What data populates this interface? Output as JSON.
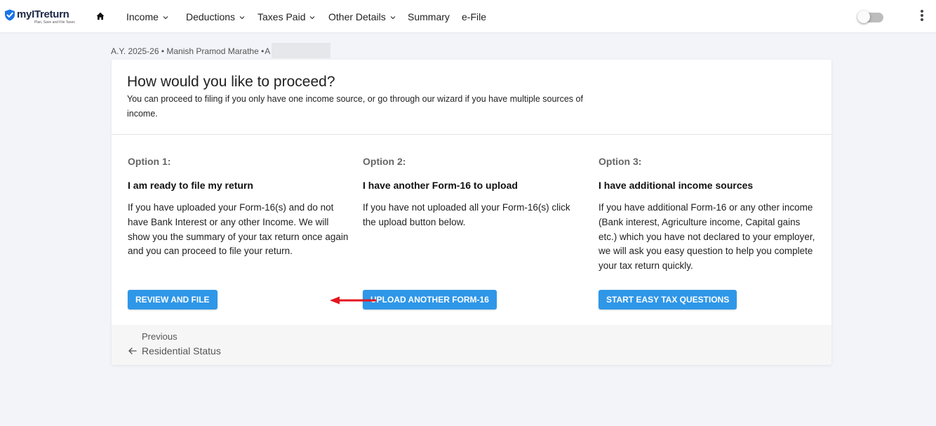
{
  "brand": {
    "name": "myITreturn",
    "tagline": "Plan, Save and File Taxes",
    "accent_color": "#1a73e8",
    "shield_icon": "shield-check-icon"
  },
  "nav": {
    "home_icon": "home-icon",
    "items": [
      {
        "label": "Income",
        "has_dropdown": true
      },
      {
        "label": "Deductions",
        "has_dropdown": true
      },
      {
        "label": "Taxes Paid",
        "has_dropdown": true
      },
      {
        "label": "Other Details",
        "has_dropdown": true
      },
      {
        "label": "Summary",
        "has_dropdown": false
      },
      {
        "label": "e-File",
        "has_dropdown": false
      }
    ],
    "toggle_on": false,
    "menu_icon": "kebab-menu-icon"
  },
  "breadcrumb": {
    "text": "A.Y. 2025-26 • Manish Pramod Marathe • ",
    "redacted_partial": "A"
  },
  "card": {
    "title": "How would you like to proceed?",
    "subtitle": "You can proceed to filing if you only have one income source, or go through our wizard if you have multiple sources of income.",
    "options": [
      {
        "label": "Option 1:",
        "heading": "I am ready to file my return",
        "description": "If you have uploaded your Form-16(s) and do not have Bank Interest or any other Income. We will show you the summary of your tax return once again and you can proceed to file your return.",
        "button": "REVIEW AND FILE"
      },
      {
        "label": "Option 2:",
        "heading": "I have another Form-16 to upload",
        "description": "If you have not uploaded all your Form-16(s) click the upload button below.",
        "button": "UPLOAD ANOTHER FORM-16"
      },
      {
        "label": "Option 3:",
        "heading": "I have additional income sources",
        "description": "If you have additional Form-16 or any other income (Bank interest, Agriculture income, Capital gains etc.) which you have not declared to your employer, we will ask you easy question to help you complete your tax return quickly.",
        "button": "START EASY TAX QUESTIONS"
      }
    ],
    "footer": {
      "previous_label": "Previous",
      "previous_link": "Residential Status"
    }
  },
  "colors": {
    "button": "#2f97e8",
    "annotation_arrow": "#e3161e",
    "background": "#f3f4f9"
  }
}
